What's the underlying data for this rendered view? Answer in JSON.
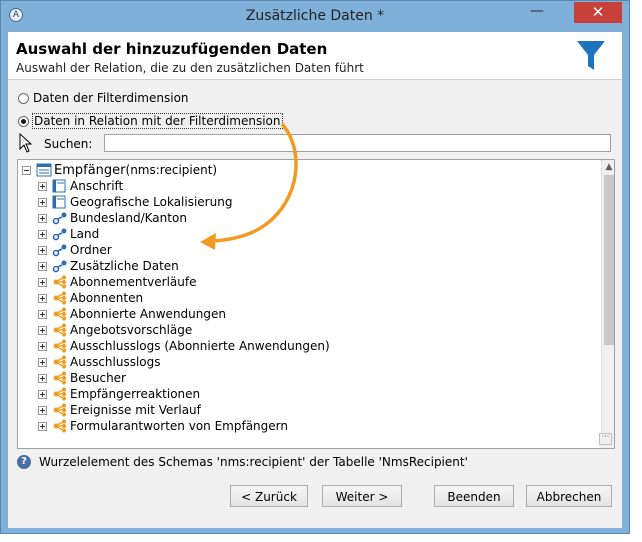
{
  "window": {
    "title": "Zusätzliche Daten *",
    "close_glyph": "✕",
    "minimize_glyph": "—"
  },
  "header": {
    "title": "Auswahl der hinzuzufügenden Daten",
    "subtitle": "Auswahl der Relation, die zu den zusätzlichen Daten führt",
    "icon": "filter-funnel-icon",
    "icon_color": "#1e73be"
  },
  "options": [
    {
      "label": "Daten der Filterdimension",
      "checked": false
    },
    {
      "label": "Daten in Relation mit der Filterdimension",
      "checked": true
    }
  ],
  "search": {
    "label": "Suchen:",
    "value": ""
  },
  "tree": {
    "root": {
      "label": "Empfänger",
      "suffix": "(nms:recipient)",
      "icon": "table-icon"
    },
    "items": [
      {
        "label": "Anschrift",
        "icon": "table-icon"
      },
      {
        "label": "Geografische Lokalisierung",
        "icon": "table-icon"
      },
      {
        "label": "Bundesland/Kanton",
        "icon": "link-icon"
      },
      {
        "label": "Land",
        "icon": "link-icon"
      },
      {
        "label": "Ordner",
        "icon": "link-icon"
      },
      {
        "label": "Zusätzliche Daten",
        "icon": "link-icon"
      },
      {
        "label": "Abonnementverläufe",
        "icon": "collection-icon"
      },
      {
        "label": "Abonnenten",
        "icon": "collection-icon"
      },
      {
        "label": "Abonnierte Anwendungen",
        "icon": "collection-icon"
      },
      {
        "label": "Angebotsvorschläge",
        "icon": "collection-icon"
      },
      {
        "label": "Ausschlusslogs (Abonnierte Anwendungen)",
        "icon": "collection-icon"
      },
      {
        "label": "Ausschlusslogs",
        "icon": "collection-icon"
      },
      {
        "label": "Besucher",
        "icon": "collection-icon"
      },
      {
        "label": "Empfängerreaktionen",
        "icon": "collection-icon"
      },
      {
        "label": "Ereignisse mit Verlauf",
        "icon": "collection-icon"
      },
      {
        "label": "Formularantworten von Empfängern",
        "icon": "collection-icon"
      }
    ]
  },
  "status": {
    "text": "Wurzelelement des Schemas 'nms:recipient' der Tabelle 'NmsRecipient'"
  },
  "buttons": {
    "back": "< Zurück",
    "next": "Weiter >",
    "finish": "Beenden",
    "cancel": "Abbrechen"
  },
  "colors": {
    "accent_orange": "#f29a1d",
    "link_blue": "#2e6db4",
    "titlebar": "#7fb0d9",
    "close_red": "#c7413a"
  }
}
